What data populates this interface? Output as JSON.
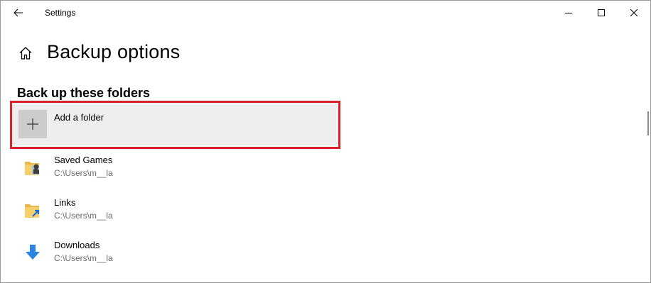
{
  "window": {
    "title": "Settings",
    "icons": {
      "back": "back-arrow-icon",
      "minimize": "minimize-icon",
      "maximize": "maximize-icon",
      "close": "close-icon"
    }
  },
  "page": {
    "title": "Backup options",
    "home_icon": "home-icon",
    "section_heading": "Back up these folders"
  },
  "add_folder": {
    "label": "Add a folder",
    "icon": "plus-icon",
    "highlight_color": "#d8222a"
  },
  "folders": [
    {
      "name": "Saved Games",
      "path": "C:\\Users\\m__la",
      "icon": "saved-games-folder-icon"
    },
    {
      "name": "Links",
      "path": "C:\\Users\\m__la",
      "icon": "links-folder-icon"
    },
    {
      "name": "Downloads",
      "path": "C:\\Users\\m__la",
      "icon": "downloads-icon"
    }
  ]
}
